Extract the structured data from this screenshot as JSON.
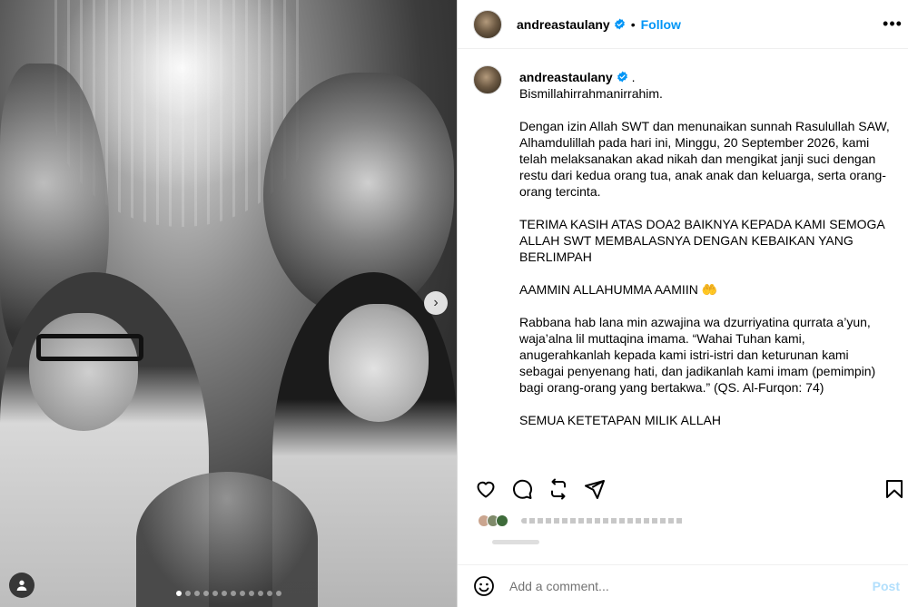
{
  "post": {
    "author": "andreastaulany",
    "follow_label": "Follow",
    "separator": "•",
    "more_label": "•••",
    "verified": true
  },
  "caption": {
    "author": "andreastaulany",
    "author_suffix": " .",
    "paragraphs": [
      "Bismillahirrahmanirrahim.",
      "Dengan izin Allah SWT dan menunaikan sunnah Rasulullah SAW, Alhamdulillah pada hari ini, Minggu, 20 September 2026, kami telah melaksanakan akad nikah dan mengikat janji suci dengan restu dari kedua orang tua, anak anak dan keluarga, serta orang-orang tercinta.",
      "TERIMA KASIH ATAS DOA2 BAIKNYA KEPADA KAMI SEMOGA ALLAH SWT MEMBALASNYA DENGAN KEBAIKAN YANG BERLIMPAH",
      "AAMMIN ALLAHUMMA AAMIIN 🤲",
      "Rabbana hab lana min azwajina wa dzurriyatina qurrata a’yun, waja’alna lil muttaqina imama. “Wahai Tuhan kami, anugerahkanlah kepada kami istri-istri dan keturunan kami sebagai penyenang hati, dan jadikanlah kami imam (pemimpin) bagi orang-orang yang bertakwa.” (QS. Al-Furqon: 74)",
      "SEMUA KETETAPAN MILIK ALLAH"
    ]
  },
  "carousel": {
    "next_label": "›",
    "slide_count": 12,
    "active_index": 0
  },
  "icons": {
    "like": "heart-icon",
    "comment": "comment-icon",
    "repost": "repost-icon",
    "share": "share-icon",
    "save": "bookmark-icon",
    "emoji": "emoji-icon",
    "tag": "user-tag-icon"
  },
  "comment": {
    "placeholder": "Add a comment...",
    "post_label": "Post"
  },
  "colors": {
    "link": "#0095f6",
    "post_disabled": "#b2dffc",
    "verified": "#0095f6"
  }
}
